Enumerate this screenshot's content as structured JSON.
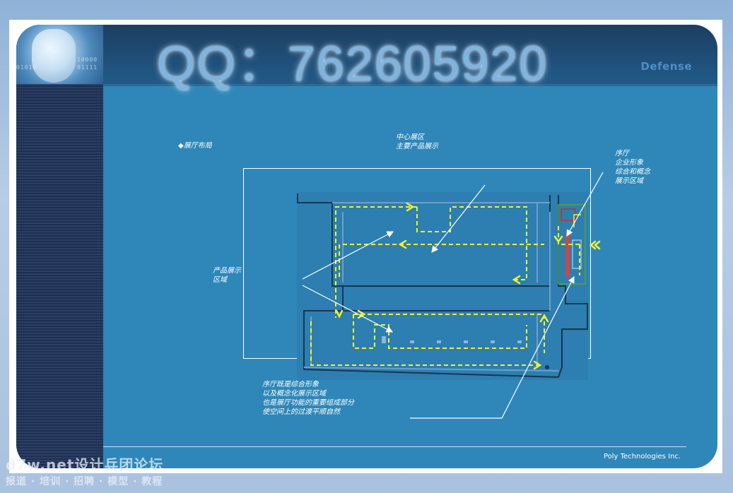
{
  "slide": {
    "brand": "Defense",
    "qq_overlay": "QQ：762605920",
    "footer_company": "Poly Technologies Inc.",
    "corner_binary": [
      "10000",
      "01010",
      "10000",
      "01111"
    ]
  },
  "diagram": {
    "section_label": "◆展厅布局",
    "center_area": [
      "中心展区",
      "主要产品展示"
    ],
    "foyer": [
      "序厅",
      "企业形象",
      "综合和概念",
      "展示区域"
    ],
    "product_area": [
      "产品展示",
      "区域"
    ],
    "foyer_note": [
      "序厅既是综合形象",
      "以及概念化展示区域",
      "也是展厅功能的重要组成部分",
      "使空间上的过渡平顺自然"
    ]
  },
  "watermark": {
    "line1": "d7w.net设计兵团论坛",
    "line2": "报道 · 培训 · 招聘 · 模型 · 教程"
  },
  "colors": {
    "slide_blue": "#2e87b8",
    "header_navy": "#1d3e62",
    "path_yellow": "#f2f230",
    "plan_line": "#6f9fc8"
  }
}
